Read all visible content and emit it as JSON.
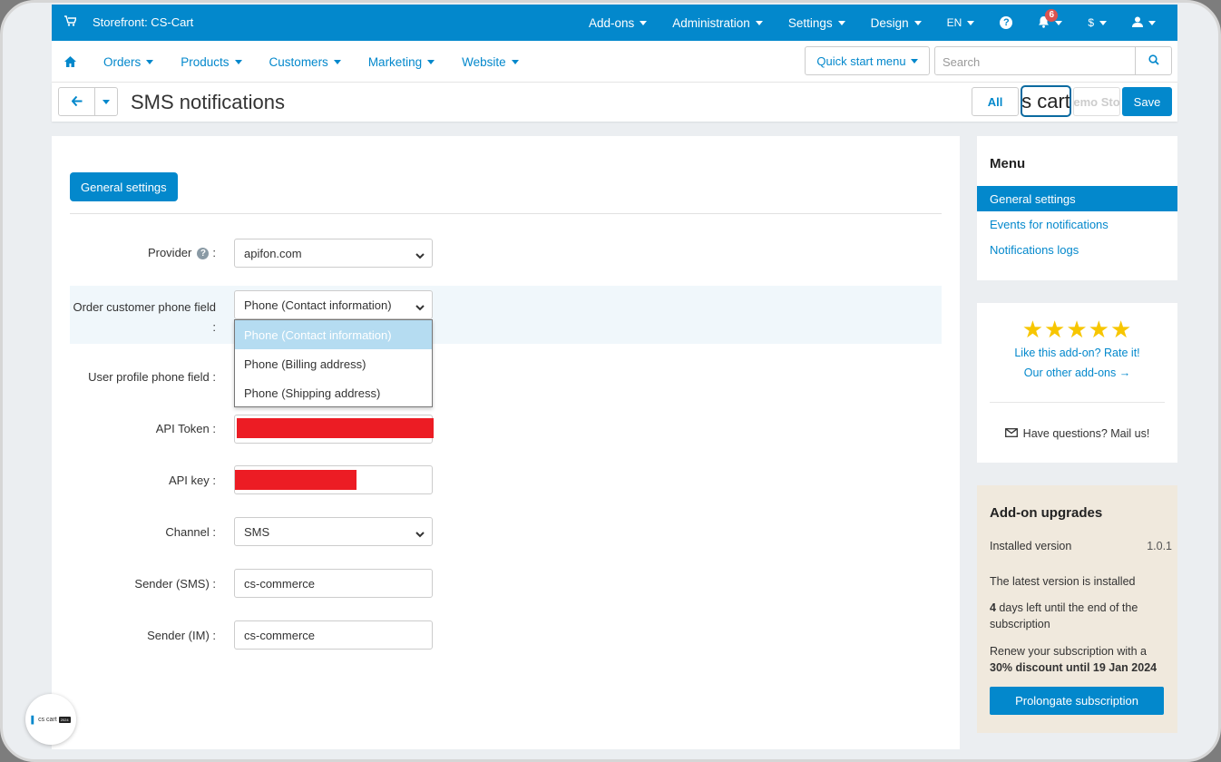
{
  "topbar": {
    "storefront": "Storefront: CS-Cart",
    "menu": [
      "Add-ons",
      "Administration",
      "Settings",
      "Design",
      "EN"
    ],
    "notifications_count": "6",
    "currency": "$"
  },
  "nav": {
    "items": [
      "Orders",
      "Products",
      "Customers",
      "Marketing",
      "Website"
    ],
    "quick_start": "Quick start menu",
    "search_placeholder": "Search"
  },
  "page": {
    "title": "SMS notifications",
    "btn_all": "All",
    "btn_cart": "s cart",
    "btn_demo": "emo Sto",
    "btn_save": "Save"
  },
  "form": {
    "tab": "General settings",
    "provider_label": "Provider",
    "provider_suffix": ":",
    "provider_value": "apifon.com",
    "order_phone_label": "Order customer phone field",
    "order_phone_suffix": ":",
    "order_phone_value": "Phone (Contact information)",
    "order_phone_options": [
      "Phone (Contact information)",
      "Phone (Billing address)",
      "Phone (Shipping address)"
    ],
    "user_phone_label": "User profile phone field :",
    "api_token_label": "API Token :",
    "api_key_label": "API key :",
    "channel_label": "Channel :",
    "channel_value": "SMS",
    "sender_sms_label": "Sender (SMS) :",
    "sender_sms_value": "cs-commerce",
    "sender_im_label": "Sender (IM) :",
    "sender_im_value": "cs-commerce"
  },
  "sidebar": {
    "menu_title": "Menu",
    "menu_items": [
      "General settings",
      "Events for notifications",
      "Notifications logs"
    ],
    "rate": {
      "stars": "★★★★★",
      "like": "Like this add-on? Rate it!",
      "other": "Our other add-ons →",
      "mail": "Have questions? Mail us!"
    },
    "upgrades": {
      "title": "Add-on upgrades",
      "installed_label": "Installed version",
      "installed_value": "1.0.1",
      "latest": "The latest version is installed",
      "days_num": "4",
      "days_text": " days left until the end of the subscription",
      "renew_text": "Renew your subscription with a ",
      "renew_bold": "30% discount until 19 Jan 2024",
      "prolong": "Prolongate subscription"
    }
  },
  "logo": {
    "text": "cs cart",
    "tag": "2024"
  },
  "colors": {
    "accent": "#0388cc",
    "redaction": "#ec1c24",
    "upgrade_bg": "#f0e9dd",
    "star": "#f7c600"
  }
}
